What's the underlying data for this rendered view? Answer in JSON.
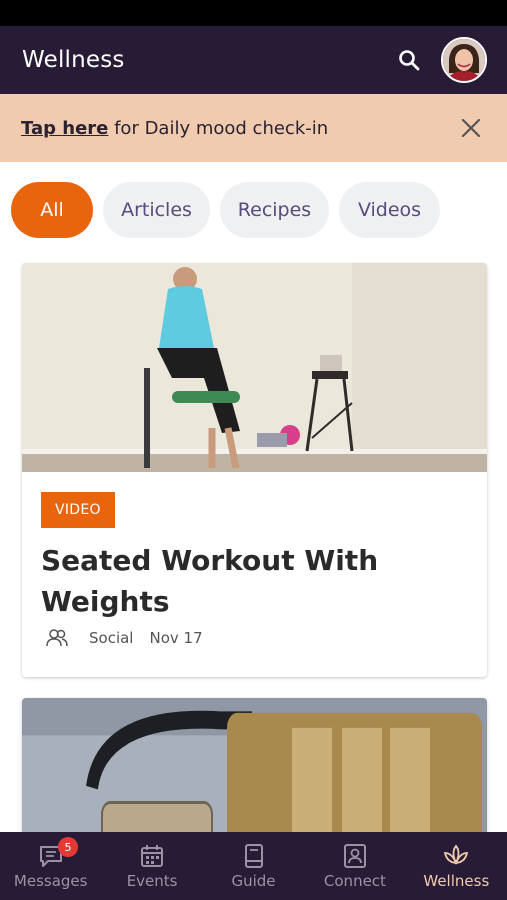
{
  "header": {
    "title": "Wellness"
  },
  "banner": {
    "link_text": "Tap here",
    "rest_text": " for Daily mood check-in"
  },
  "filters": [
    {
      "label": "All",
      "active": true
    },
    {
      "label": "Articles",
      "active": false
    },
    {
      "label": "Recipes",
      "active": false
    },
    {
      "label": "Videos",
      "active": false
    }
  ],
  "cards": [
    {
      "tag": "VIDEO",
      "title": "Seated Workout With Weights",
      "category": "Social",
      "date": "Nov 17"
    }
  ],
  "nav": [
    {
      "label": "Messages",
      "badge": "5"
    },
    {
      "label": "Events"
    },
    {
      "label": "Guide"
    },
    {
      "label": "Connect"
    },
    {
      "label": "Wellness",
      "active": true
    }
  ],
  "colors": {
    "header_bg": "#271b35",
    "accent": "#e8640d",
    "banner_bg": "#f1cbb0",
    "nav_active": "#f1cbb0"
  }
}
